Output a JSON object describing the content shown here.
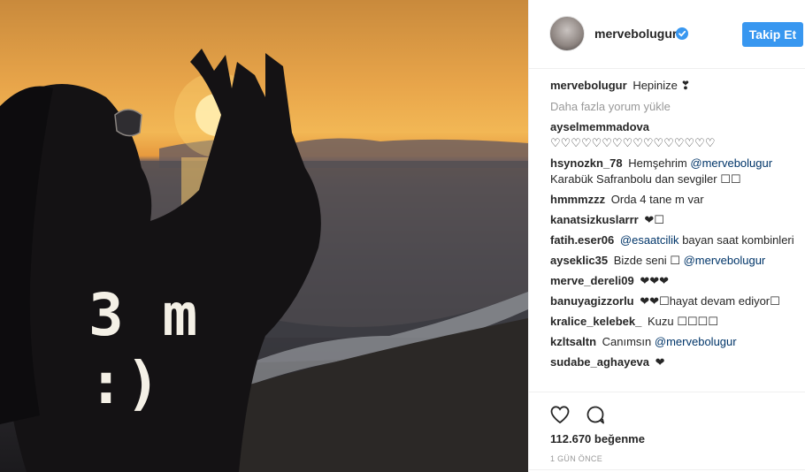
{
  "post": {
    "overlay_text": "3 m :)"
  },
  "header": {
    "username": "mervebolugur",
    "follow_label": "Takip Et"
  },
  "caption": {
    "user": "mervebolugur",
    "text": "Hepinize ❣"
  },
  "load_more": "Daha fazla yorum yükle",
  "comments": [
    {
      "user": "ayselmemmadova",
      "text": "♡♡♡♡♡♡♡♡♡♡♡♡♡♡♡♡",
      "mention": "",
      "after": ""
    },
    {
      "user": "hsynozkn_78",
      "text": "Hemşehrim",
      "mention": "@mervebolugur",
      "after": "Karabük Safranbolu dan sevgiler ☐☐"
    },
    {
      "user": "hmmmzzz",
      "text": "Orda 4 tane m var",
      "mention": "",
      "after": ""
    },
    {
      "user": "kanatsizkuslarrr",
      "text": "❤☐",
      "mention": "",
      "after": ""
    },
    {
      "user": "fatih.eser06",
      "text": "",
      "mention": "@esaatcilik",
      "after": "bayan saat kombinleri"
    },
    {
      "user": "ayseklic35",
      "text": "Bizde seni ☐",
      "mention": "@mervebolugur",
      "after": ""
    },
    {
      "user": "merve_dereli09",
      "text": "❤❤❤",
      "mention": "",
      "after": ""
    },
    {
      "user": "banuyagizzorlu",
      "text": "❤❤☐hayat devam ediyor☐",
      "mention": "",
      "after": ""
    },
    {
      "user": "kralice_kelebek_",
      "text": "Kuzu ☐☐☐☐",
      "mention": "",
      "after": ""
    },
    {
      "user": "kzltsaltn",
      "text": "Canımsın",
      "mention": "@mervebolugur",
      "after": ""
    },
    {
      "user": "sudabe_aghayeva",
      "text": "❤",
      "mention": "",
      "after": ""
    }
  ],
  "actions": {
    "likes": "112.670 beğenme",
    "time": "1 GÜN ÖNCE"
  },
  "colors": {
    "accent": "#3897f0",
    "mention": "#003569",
    "muted": "#999999"
  },
  "icons": [
    "verified-badge-icon",
    "heart-icon",
    "comment-icon"
  ]
}
